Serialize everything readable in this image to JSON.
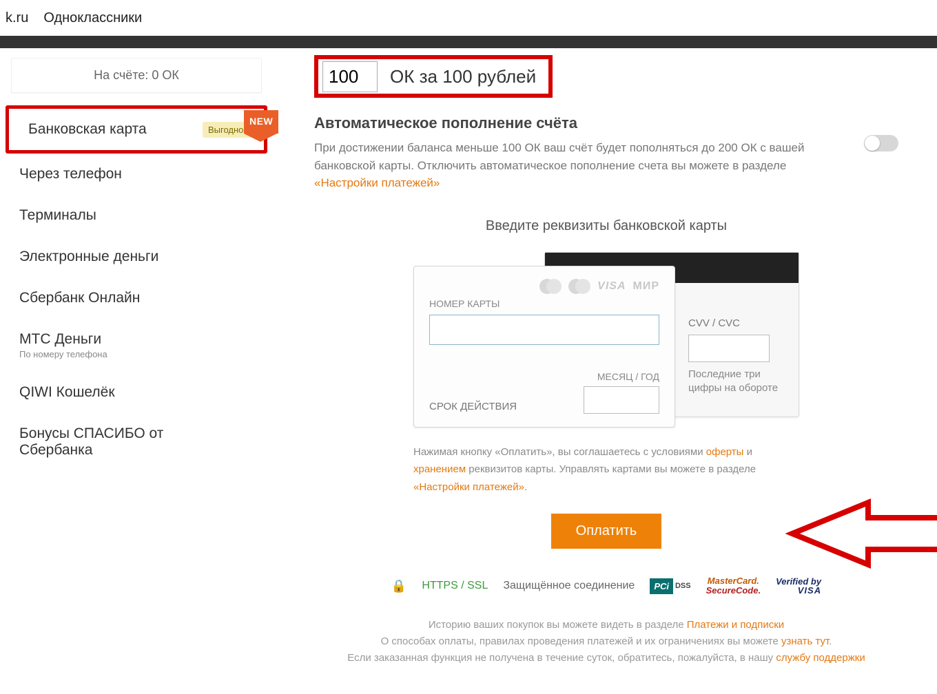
{
  "top": {
    "domain": "k.ru",
    "sitename": "Одноклассники"
  },
  "sidebar": {
    "balance": "На счёте: 0 ОК",
    "items": [
      {
        "label": "Банковская карта",
        "badge": "Выгодно!",
        "active": true
      },
      {
        "label": "Через телефон"
      },
      {
        "label": "Терминалы"
      },
      {
        "label": "Электронные деньги"
      },
      {
        "label": "Сбербанк Онлайн"
      },
      {
        "label": "МТС Деньги",
        "sub": "По номеру телефона"
      },
      {
        "label": "QIWI Кошелёк"
      },
      {
        "label": "Бонусы СПАСИБО от Сбербанка"
      }
    ]
  },
  "amount": {
    "value": "100",
    "text": "ОК за 100 рублей"
  },
  "new_badge": "NEW",
  "auto": {
    "title": "Автоматическое пополнение счёта",
    "desc1": "При достижении баланса меньше 100 ОК ваш счёт будет пополняться до 200 ОК с вашей банковской карты. Отключить автоматическое пополнение счета вы можете в разделе ",
    "link": "«Настройки платежей»"
  },
  "card": {
    "title": "Введите реквизиты банковской карты",
    "num_label": "НОМЕР КАРТЫ",
    "brands_visa": "VISA",
    "brands_mir": "МИР",
    "expiry_label": "СРОК ДЕЙСТВИЯ",
    "expiry_head": "МЕСЯЦ / ГОД",
    "cvv_label": "CVV / CVC",
    "cvv_hint": "Последние три цифры на обороте"
  },
  "agree": {
    "t1": "Нажимая кнопку «Оплатить», вы соглашаетесь с условиями ",
    "offer": "оферты",
    "t2": " и ",
    "storage": "хранением",
    "t3": " реквизитов карты. Управлять картами вы можете в разделе ",
    "settings": "«Настройки платежей»",
    "dot": "."
  },
  "pay_button": "Оплатить",
  "secure": {
    "https": "HTTPS / SSL",
    "text": "Защищённое соединение",
    "pci": "PCi",
    "dss": "DSS",
    "msc1": "MasterCard.",
    "msc2": "SecureCode.",
    "vbv1": "Verified by",
    "vbv2": "VISA"
  },
  "footer": {
    "l1a": "Историю ваших покупок вы можете видеть в разделе ",
    "l1link": "Платежи и подписки",
    "l2a": "О способах оплаты, правилах проведения платежей и их ограничениях вы можете ",
    "l2link": "узнать тут",
    "l2dot": ".",
    "l3a": "Если заказанная функция не получена в течение суток, обратитесь, пожалуйста, в нашу ",
    "l3link": "службу поддержки"
  }
}
